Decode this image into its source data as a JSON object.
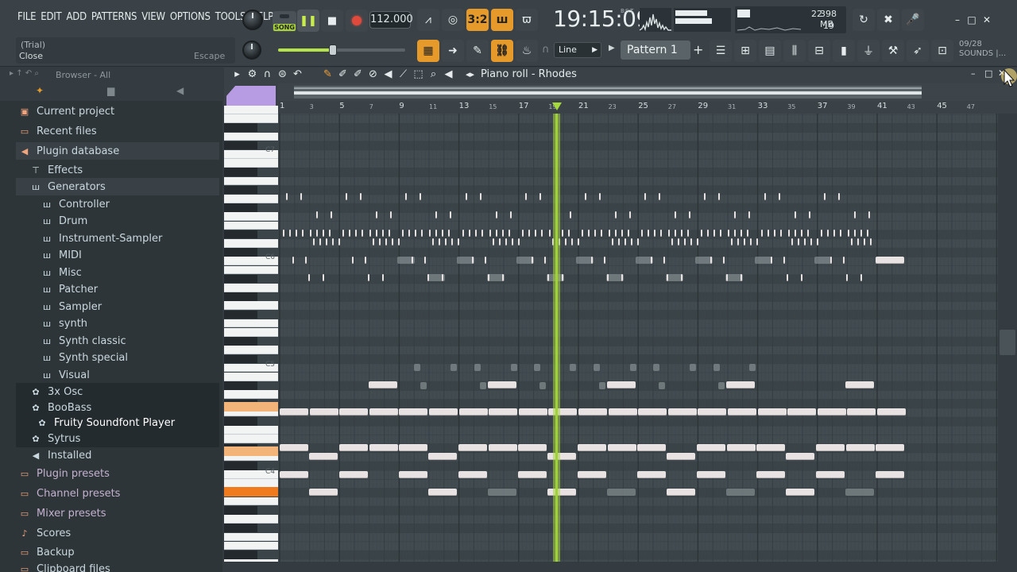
{
  "menu": [
    "FILE",
    "EDIT",
    "ADD",
    "PATTERNS",
    "VIEW",
    "OPTIONS",
    "TOOLS",
    "HELP"
  ],
  "transport": {
    "song_label": "SONG",
    "play_icon": "pause-icon",
    "stop_icon": "stop-icon",
    "record_icon": "record-icon",
    "tempo": "112.000"
  },
  "clock": {
    "time": "19:15:09",
    "sub": "B:S:T"
  },
  "cpu": {
    "value": "22",
    "memory": "398 MB",
    "polyphony": "19"
  },
  "hint": {
    "title": "(Trial)",
    "action": "Close",
    "shortcut": "Escape"
  },
  "snap": {
    "value": "Line"
  },
  "pattern": {
    "name": "Pattern 1",
    "add_label": "+"
  },
  "sounds": {
    "date": "09/28",
    "label": "SOUNDS |..."
  },
  "browser": {
    "title": "Browser - All",
    "items": [
      {
        "label": "Current project",
        "icon": "project-icon"
      },
      {
        "label": "Recent files",
        "icon": "folder-icon"
      },
      {
        "label": "Plugin database",
        "icon": "plugin-icon"
      },
      {
        "label": "Effects",
        "icon": "effects-icon"
      },
      {
        "label": "Generators",
        "icon": "generators-icon"
      },
      {
        "label": "Controller",
        "icon": "generator-icon"
      },
      {
        "label": "Drum",
        "icon": "generator-icon"
      },
      {
        "label": "Instrument-Sampler",
        "icon": "generator-icon"
      },
      {
        "label": "MIDI",
        "icon": "generator-icon"
      },
      {
        "label": "Misc",
        "icon": "generator-icon"
      },
      {
        "label": "Patcher",
        "icon": "generator-icon"
      },
      {
        "label": "Sampler",
        "icon": "generator-icon"
      },
      {
        "label": "synth",
        "icon": "generator-icon"
      },
      {
        "label": "Synth classic",
        "icon": "generator-icon"
      },
      {
        "label": "Synth special",
        "icon": "generator-icon"
      },
      {
        "label": "Visual",
        "icon": "generator-icon"
      },
      {
        "label": "3x Osc",
        "icon": "gear-icon"
      },
      {
        "label": "BooBass",
        "icon": "gear-icon"
      },
      {
        "label": "Fruity Soundfont Player",
        "icon": "gear-icon"
      },
      {
        "label": "Sytrus",
        "icon": "gear-icon"
      },
      {
        "label": "Installed",
        "icon": "plugin-icon"
      },
      {
        "label": "Plugin presets",
        "icon": "presets-icon"
      },
      {
        "label": "Channel presets",
        "icon": "presets-icon"
      },
      {
        "label": "Mixer presets",
        "icon": "presets-icon"
      },
      {
        "label": "Scores",
        "icon": "note-icon"
      },
      {
        "label": "Backup",
        "icon": "folder-icon"
      },
      {
        "label": "Clipboard files",
        "icon": "folder-icon"
      }
    ]
  },
  "piano_roll": {
    "title": "Piano roll - Rhodes",
    "octave_labels": [
      "C7",
      "C6",
      "C5",
      "C4"
    ],
    "ruler_major": [
      "1",
      "5",
      "9",
      "13",
      "17",
      "21",
      "25",
      "29",
      "33",
      "37",
      "41",
      "45"
    ],
    "ruler_minor": [
      "3",
      "7",
      "11",
      "15",
      "19",
      "23",
      "27",
      "31",
      "35",
      "39",
      "43",
      "47"
    ],
    "playhead_bar": 19.5
  },
  "colors": {
    "accent": "#e69a2a",
    "play": "#9fd13a",
    "note": "#e8e2e2"
  }
}
